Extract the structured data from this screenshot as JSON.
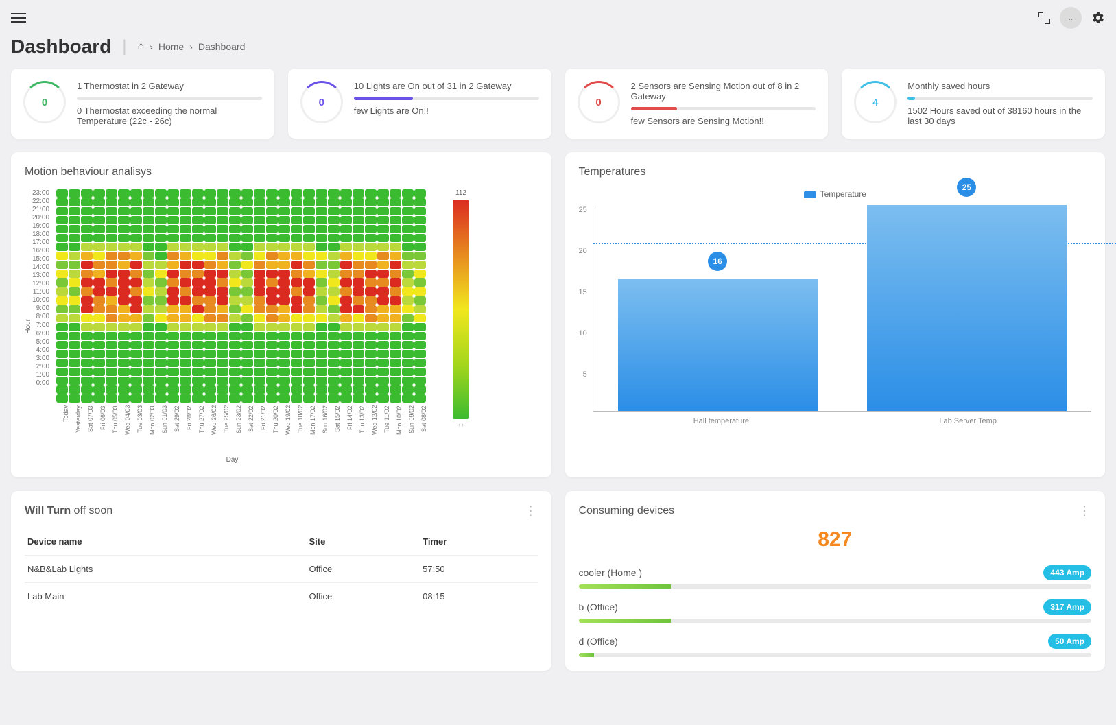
{
  "topbar": {
    "avatar_initials": ".."
  },
  "header": {
    "title": "Dashboard",
    "breadcrumb": {
      "home": "Home",
      "current": "Dashboard"
    }
  },
  "stats": [
    {
      "value": "0",
      "color": "#3eb864",
      "line1": "1 Thermostat in 2 Gateway",
      "bar_pct": 0,
      "bar_color": "#3eb864",
      "line2": "0 Thermostat exceeding the normal Temperature (22c - 26c)"
    },
    {
      "value": "0",
      "color": "#6b53ea",
      "line1": "10 Lights are On out of 31 in 2 Gateway",
      "bar_pct": 32,
      "bar_color": "#6b53ea",
      "line2": "few Lights are On!!"
    },
    {
      "value": "0",
      "color": "#e24b4b",
      "line1": "2 Sensors are Sensing Motion out of 8 in 2 Gateway",
      "bar_pct": 25,
      "bar_color": "#e24b4b",
      "line2": "few Sensors are Sensing Motion!!"
    },
    {
      "value": "4",
      "color": "#3fbfe6",
      "line1": "Monthly saved hours",
      "bar_pct": 4,
      "bar_color": "#3fbfe6",
      "line2": "1502 Hours saved out of 38160 hours in the last 30 days"
    }
  ],
  "motion": {
    "title": "Motion behaviour analisys",
    "ylabel": "Hour",
    "xlabel": "Day",
    "hours": [
      "23:00",
      "22:00",
      "21:00",
      "20:00",
      "19:00",
      "18:00",
      "17:00",
      "16:00",
      "15:00",
      "14:00",
      "13:00",
      "12:00",
      "11:00",
      "10:00",
      "9:00",
      "8:00",
      "7:00",
      "6:00",
      "5:00",
      "4:00",
      "3:00",
      "2:00",
      "1:00",
      "0:00"
    ],
    "days": [
      "Today",
      "Yesterday",
      "Sat 07/03",
      "Fri 06/03",
      "Thu 05/03",
      "Wed 04/03",
      "Tue 03/03",
      "Mon 02/03",
      "Sun 01/03",
      "Sat 29/02",
      "Fri 28/02",
      "Thu 27/02",
      "Wed 26/02",
      "Tue 25/02",
      "Sun 23/02",
      "Sat 22/02",
      "Fri 21/02",
      "Thu 20/02",
      "Wed 19/02",
      "Tue 18/02",
      "Mon 17/02",
      "Sun 16/02",
      "Sat 15/02",
      "Fri 14/02",
      "Thu 13/02",
      "Wed 12/02",
      "Tue 11/02",
      "Mon 10/02",
      "Sun 09/02",
      "Sat 08/02"
    ],
    "colorbar": {
      "min": "0",
      "max": "112"
    }
  },
  "temperatures": {
    "title": "Temperatures",
    "legend": "Temperature",
    "threshold": 20.5,
    "threshold_label": "20.5"
  },
  "will_turn": {
    "title_bold": "Will Turn",
    "title_rest": " off soon",
    "cols": {
      "name": "Device name",
      "site": "Site",
      "timer": "Timer"
    },
    "rows": [
      {
        "name": "N&B&Lab Lights",
        "site": "Office",
        "timer": "57:50"
      },
      {
        "name": "Lab Main",
        "site": "Office",
        "timer": "08:15"
      }
    ]
  },
  "consuming": {
    "title": "Consuming devices",
    "total": "827",
    "rows": [
      {
        "label": "cooler (Home )",
        "value": "443 Amp",
        "pct": 18
      },
      {
        "label": "b (Office)",
        "value": "317 Amp",
        "pct": 18
      },
      {
        "label": "d (Office)",
        "value": "50 Amp",
        "pct": 3
      }
    ]
  },
  "chart_data": {
    "type": "bar",
    "categories": [
      "Hall temperature",
      "Lab Server Temp"
    ],
    "values": [
      16,
      25
    ],
    "series_name": "Temperature",
    "ylim": [
      0,
      25
    ],
    "yticks": [
      5,
      10,
      15,
      20,
      25
    ],
    "threshold": 20.5,
    "title": "Temperatures",
    "xlabel": "",
    "ylabel": ""
  }
}
